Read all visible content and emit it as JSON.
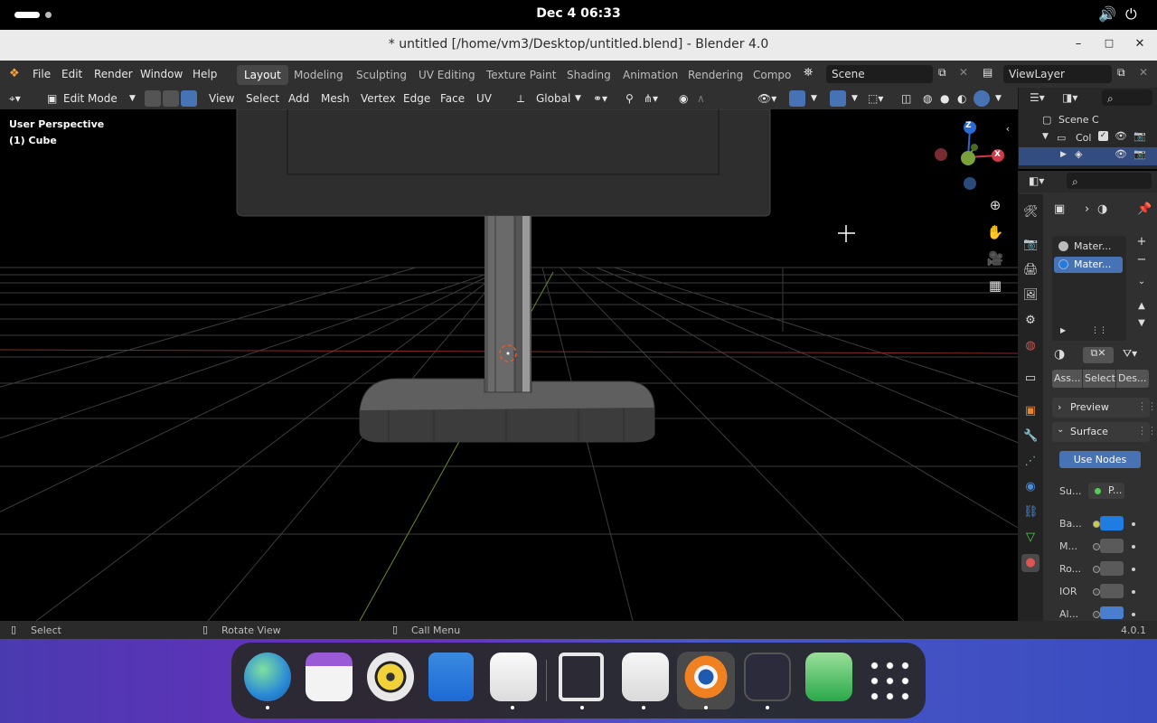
{
  "topbar": {
    "clock": "Dec 4  06:33",
    "volume_icon": "volume-icon",
    "power_icon": "power-icon"
  },
  "window": {
    "title": "* untitled [/home/vm3/Desktop/untitled.blend] - Blender 4.0",
    "minimize": "–",
    "maximize": "□",
    "close": "✕"
  },
  "menu": {
    "items": [
      "File",
      "Edit",
      "Render",
      "Window",
      "Help"
    ]
  },
  "workspaces": [
    "Layout",
    "Modeling",
    "Sculpting",
    "UV Editing",
    "Texture Paint",
    "Shading",
    "Animation",
    "Rendering",
    "Compo"
  ],
  "scene": {
    "name": "Scene",
    "view_layer": "ViewLayer"
  },
  "header": {
    "mode": "Edit Mode",
    "menus": [
      "View",
      "Select",
      "Add",
      "Mesh",
      "Vertex",
      "Edge",
      "Face",
      "UV"
    ],
    "orientation": "Global"
  },
  "viewport": {
    "perspective": "User Perspective",
    "object": "(1) Cube",
    "gizmo_axes": {
      "z": "Z",
      "x": "X"
    }
  },
  "outliner": {
    "scene_collection": "Scene C",
    "collection": "Col"
  },
  "materials": {
    "slots": [
      "Mater...",
      "Mater..."
    ],
    "buttons": [
      "Ass...",
      "Select",
      "Des..."
    ]
  },
  "panels": {
    "preview": "Preview",
    "surface": "Surface",
    "use_nodes": "Use Nodes"
  },
  "surface_props": [
    {
      "label": "Su...",
      "value": "P..."
    },
    {
      "label": "Ba...",
      "color": "#1f7ce0"
    },
    {
      "label": "M...",
      "color": "#5a5a5a"
    },
    {
      "label": "Ro...",
      "color": "#5a5a5a"
    },
    {
      "label": "IOR",
      "color": "#5a5a5a"
    },
    {
      "label": "Al...",
      "color": "#4a7fd0"
    }
  ],
  "status": {
    "select": "Select",
    "rotate": "Rotate View",
    "call_menu": "Call Menu",
    "version": "4.0.1"
  },
  "colors": {
    "accent": "#4772b3",
    "base_color": "#1f7ce0",
    "dock_bg": "#282828"
  },
  "dock": {
    "apps": [
      "browser-icon",
      "calendar-icon",
      "music-icon",
      "files-icon",
      "software-icon",
      "screenshot-icon",
      "text-editor-icon",
      "blender-icon",
      "terminal-icon",
      "trash-icon",
      "app-grid-icon"
    ]
  }
}
